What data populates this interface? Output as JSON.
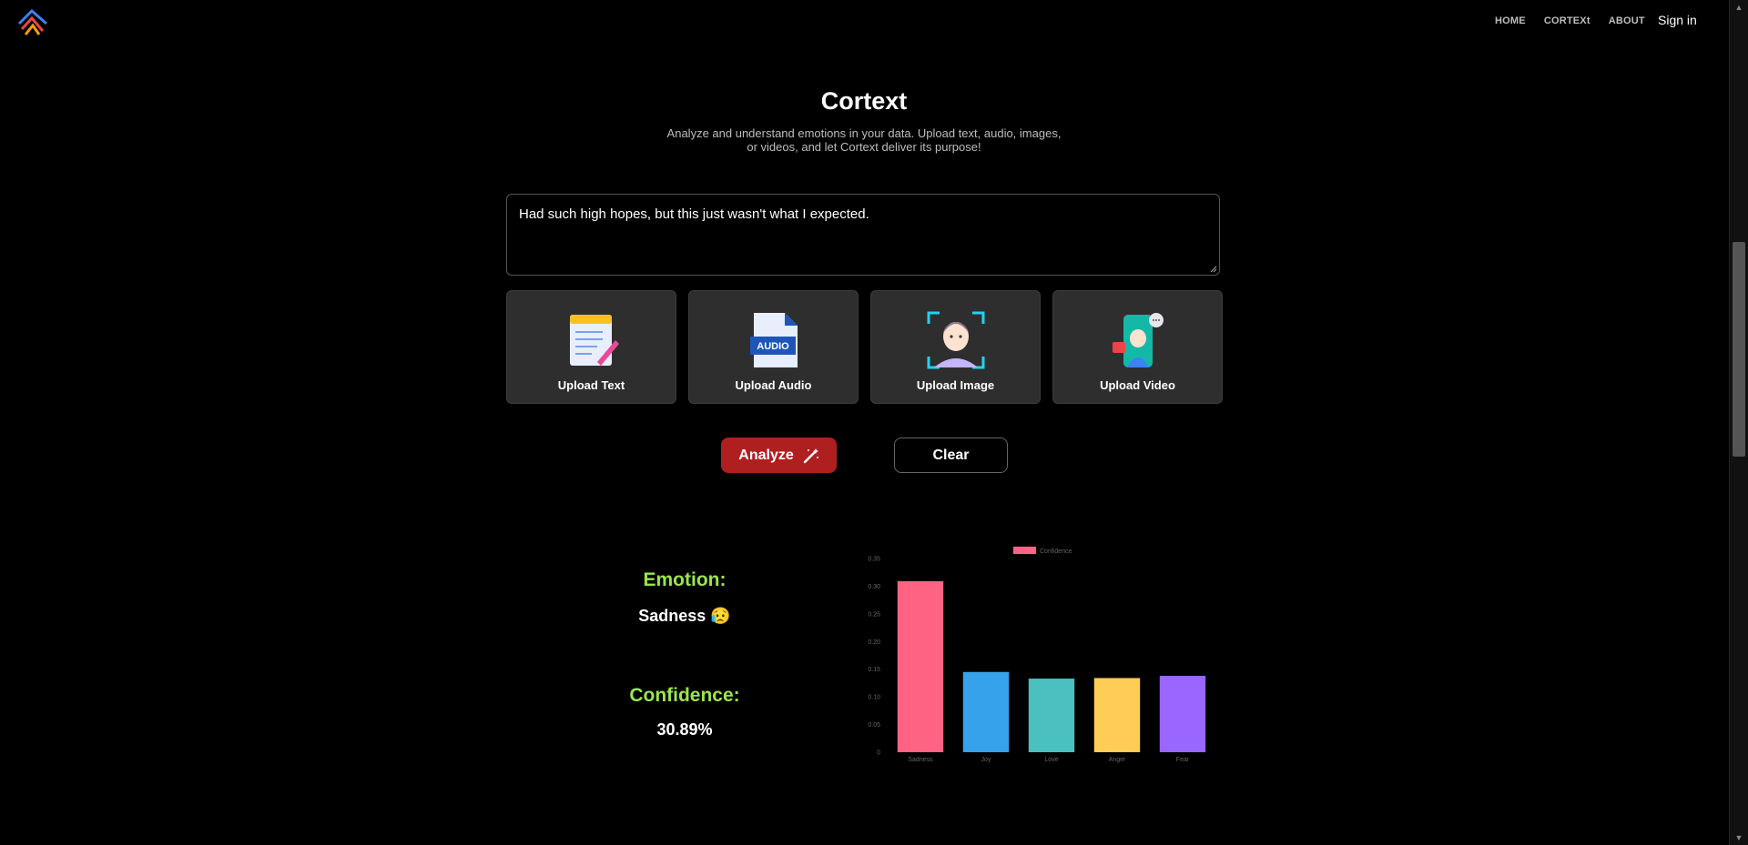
{
  "nav": {
    "items": [
      "HOME",
      "CORTEXt",
      "ABOUT"
    ],
    "signin": "Sign in"
  },
  "hero": {
    "title": "Cortext",
    "subtitle": "Analyze and understand emotions in your data. Upload text, audio, images, or videos, and let Cortext deliver its purpose!"
  },
  "input": {
    "value": "Had such high hopes, but this just wasn't what I expected."
  },
  "uploads": [
    {
      "label": "Upload Text",
      "icon": "notepad-icon"
    },
    {
      "label": "Upload Audio",
      "icon": "audio-file-icon",
      "badge": "AUDIO"
    },
    {
      "label": "Upload Image",
      "icon": "face-scan-icon"
    },
    {
      "label": "Upload Video",
      "icon": "video-call-icon"
    }
  ],
  "actions": {
    "analyze": "Analyze",
    "clear": "Clear"
  },
  "result": {
    "emotion_label": "Emotion:",
    "emotion_value": "Sadness 😥",
    "confidence_label": "Confidence:",
    "confidence_value": "30.89%"
  },
  "colors": {
    "accent_red": "#b01f1f",
    "label_green": "#9ae64b"
  },
  "chart_data": {
    "type": "bar",
    "categories": [
      "Sadness",
      "Joy",
      "Love",
      "Anger",
      "Fear"
    ],
    "series": [
      {
        "name": "Confidence",
        "values": [
          0.3089,
          0.145,
          0.133,
          0.134,
          0.138
        ]
      }
    ],
    "colors": [
      "#ff6384",
      "#36a2eb",
      "#4bc0c0",
      "#ffcd56",
      "#9966ff"
    ],
    "yticks": [
      "0",
      "0.05",
      "0.10",
      "0.15",
      "0.20",
      "0.25",
      "0.30",
      "0.35"
    ],
    "ylim": [
      0,
      0.35
    ],
    "legend": "top"
  }
}
